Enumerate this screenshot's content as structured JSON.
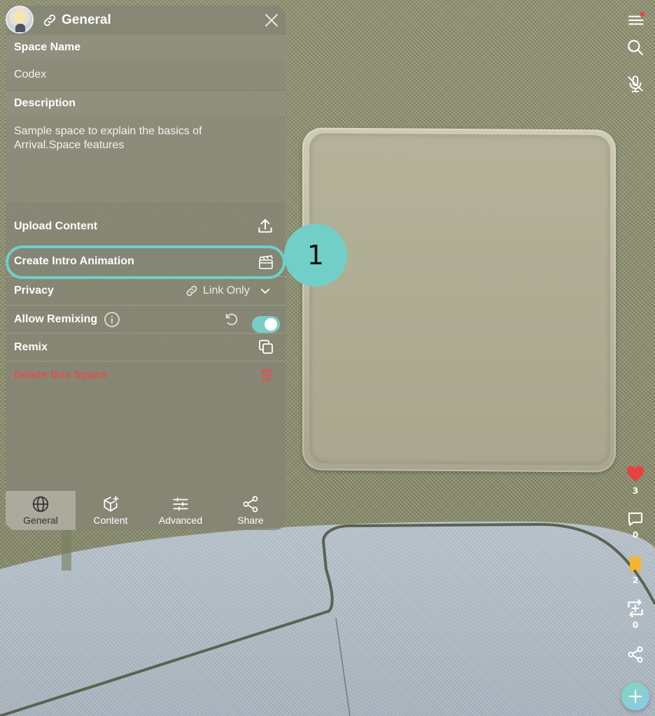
{
  "panel": {
    "title": "General",
    "space_name_label": "Space Name",
    "space_name_value": "Codex",
    "description_label": "Description",
    "description_value": "Sample space to explain the basics of Arrival.Space features",
    "upload_label": "Upload Content",
    "intro_label": "Create Intro Animation",
    "privacy_label": "Privacy",
    "privacy_value": "Link Only",
    "remixing_label": "Allow Remixing",
    "remixing_enabled": true,
    "remix_label": "Remix",
    "delete_label": "Delete this Space"
  },
  "tabs": [
    {
      "label": "General",
      "icon": "globe-icon",
      "active": true
    },
    {
      "label": "Content",
      "icon": "cube-add-icon",
      "active": false
    },
    {
      "label": "Advanced",
      "icon": "sliders-icon",
      "active": false
    },
    {
      "label": "Share",
      "icon": "share-icon",
      "active": false
    }
  ],
  "callout": {
    "number": "1"
  },
  "sidebar": {
    "likes": "3",
    "comments": "0",
    "bookmarks": "2",
    "reposts": "0"
  },
  "colors": {
    "accent": "#72cfc8",
    "danger": "#d9534f",
    "like": "#e8423f",
    "bookmark": "#f2b632"
  }
}
